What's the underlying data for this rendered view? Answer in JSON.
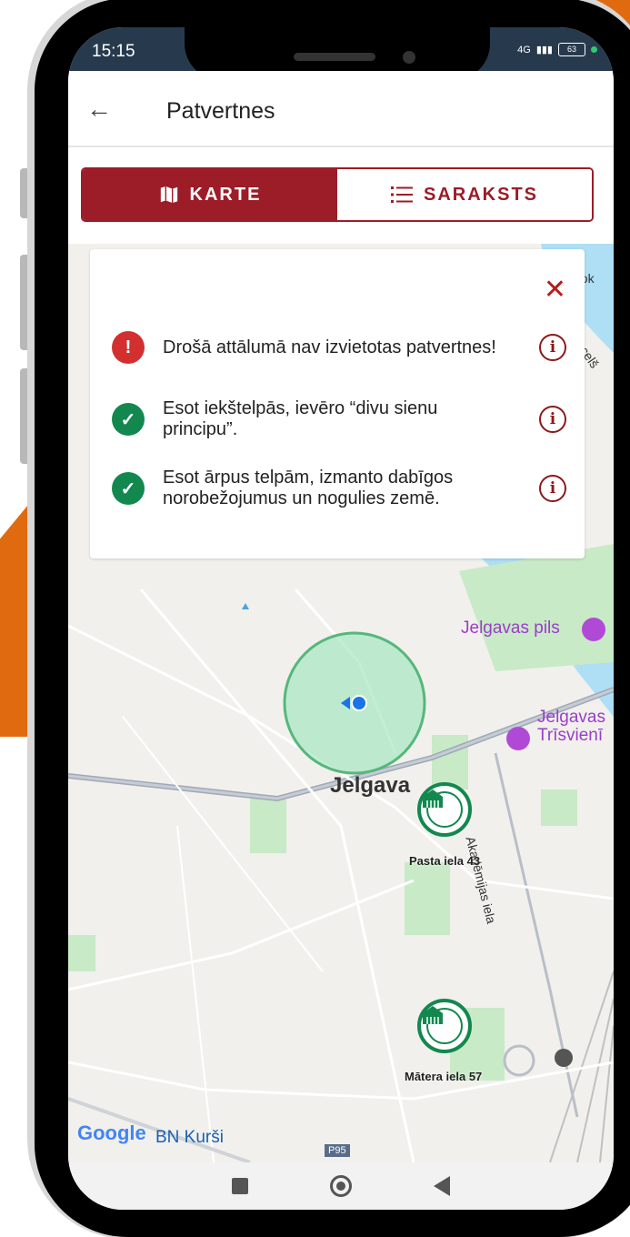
{
  "status_bar": {
    "time": "15:15",
    "network": "4G",
    "battery": "63"
  },
  "app_bar": {
    "title": "Patvertnes",
    "back_icon": "arrow-left-icon"
  },
  "tabs": [
    {
      "label": "KARTE",
      "icon": "map-icon",
      "active": true
    },
    {
      "label": "SARAKSTS",
      "icon": "list-icon",
      "active": false
    }
  ],
  "warning_card": {
    "tips": [
      {
        "text": "Drošā attālumā nav izvietotas patvertnes!",
        "status": "error",
        "status_icon": "!"
      },
      {
        "text": "Esot iekštelpās, ievēro “divu sienu principu”.",
        "status": "ok",
        "status_icon": "✓"
      },
      {
        "text": "Esot ārpus telpām, izmanto dabīgos norobežojumus un nogulies zemē.",
        "status": "ok",
        "status_icon": "✓"
      }
    ],
    "info_glyph": "i"
  },
  "map": {
    "city": "Jelgava",
    "pois": [
      "Jelgavas pils",
      "Jelgavas",
      "Trīsvienī"
    ],
    "street_labels": [
      "Akadēmijas iela",
      "a celš",
      "Lok",
      "BN Kurši",
      "P95"
    ],
    "shelters": [
      {
        "label": "Pasta iela 43"
      },
      {
        "label": "Mātera iela 57"
      }
    ],
    "attribution": "Google",
    "colors": {
      "radius_fill": "#a6e7c3",
      "radius_stroke": "#56b77a",
      "water": "#aedff5",
      "park": "#c8eac6"
    }
  },
  "colors": {
    "accent": "#9c1c27",
    "ok": "#12884e",
    "error": "#d32f2f"
  }
}
